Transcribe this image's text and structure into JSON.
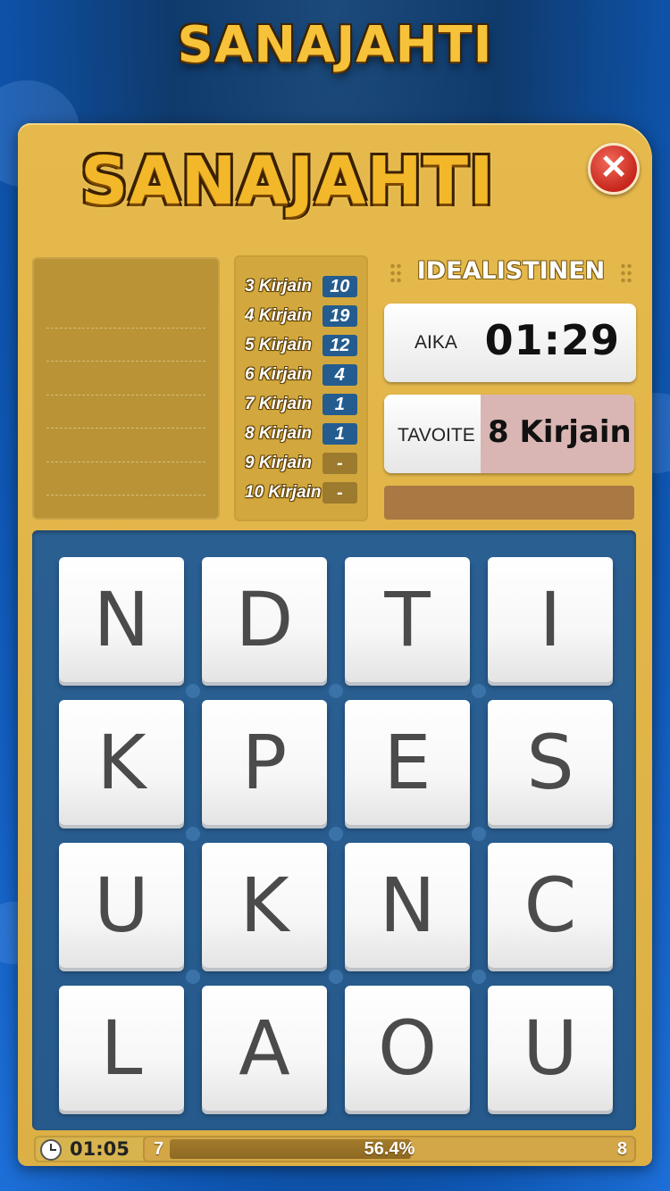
{
  "app_title": "SANAJAHTI",
  "panel": {
    "title": "SANAJAHTI",
    "close_symbol": "✕",
    "difficulty": "IDEALISTINEN",
    "time_label": "AIKA",
    "time_value": "01:29",
    "target_label": "TAVOITE",
    "target_value": "8 Kirjain"
  },
  "word_counts": [
    {
      "label": "3 Kirjain",
      "value": "10"
    },
    {
      "label": "4 Kirjain",
      "value": "19"
    },
    {
      "label": "5 Kirjain",
      "value": "12"
    },
    {
      "label": "6 Kirjain",
      "value": "4"
    },
    {
      "label": "7 Kirjain",
      "value": "1"
    },
    {
      "label": "8 Kirjain",
      "value": "1"
    },
    {
      "label": "9 Kirjain",
      "value": "-"
    },
    {
      "label": "10 Kirjain",
      "value": "-"
    }
  ],
  "board": {
    "letters": [
      [
        "N",
        "D",
        "T",
        "I"
      ],
      [
        "K",
        "P",
        "E",
        "S"
      ],
      [
        "U",
        "K",
        "N",
        "C"
      ],
      [
        "L",
        "A",
        "O",
        "U"
      ]
    ]
  },
  "footer": {
    "timer": "01:05",
    "progress_start": "7",
    "progress_end": "8",
    "progress_percent": "56.4%",
    "progress_fraction": 0.564
  },
  "icons": {
    "close": "close-icon",
    "clock": "clock-icon"
  },
  "colors": {
    "board_blue": "#2a5f92",
    "panel_gold": "#e6b94c",
    "count_badge": "#245c8f",
    "close_red": "#c6261c",
    "target_highlight": "#d9b6b3"
  }
}
